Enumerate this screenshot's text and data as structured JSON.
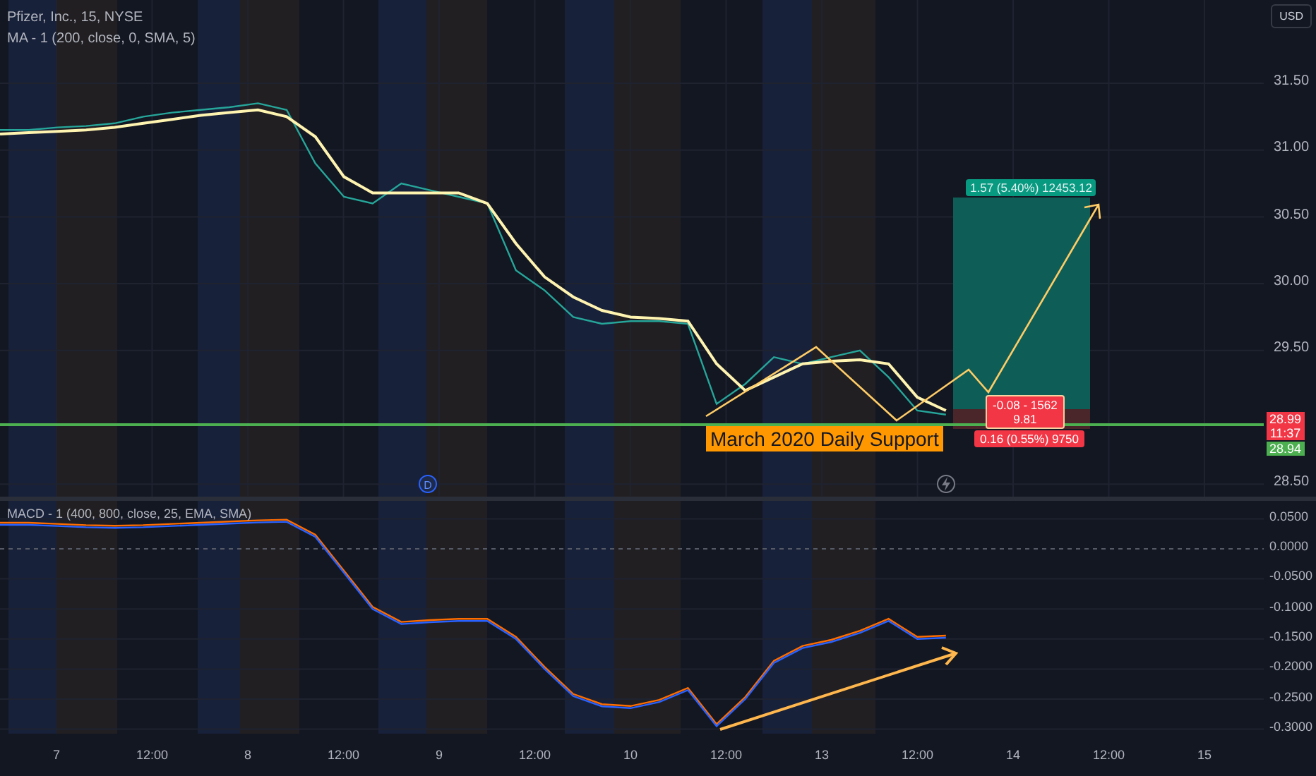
{
  "header": {
    "symbol": "Pfizer, Inc., 15, NYSE",
    "indicator": "MA - 1 (200, close, 0, SMA, 5)"
  },
  "currency_button": "USD",
  "price_pane": {
    "axis_labels": [
      "31.50",
      "31.00",
      "30.50",
      "30.00",
      "29.50",
      "28.50"
    ],
    "support_label": "March 2020 Daily Support",
    "position": {
      "target_label": "1.57 (5.40%) 12453.12",
      "pnl_lines": [
        "-0.08 - 1562",
        "9.81"
      ],
      "stop_label": "0.16 (0.55%) 9750"
    },
    "price_tags": [
      {
        "lines": [
          "28.99",
          "11:37"
        ],
        "color": "#f23645"
      },
      {
        "lines": [
          "28.94"
        ],
        "color": "#4caf50"
      }
    ],
    "dividend_marker": "D"
  },
  "macd_pane": {
    "legend": "MACD - 1 (400, 800, close, 25, EMA, SMA)",
    "axis_labels": [
      "0.0500",
      "0.0000",
      "-0.0500",
      "-0.1000",
      "-0.1500",
      "-0.2000",
      "-0.2500",
      "-0.3000"
    ]
  },
  "time_axis": [
    "7",
    "12:00",
    "8",
    "12:00",
    "9",
    "12:00",
    "10",
    "12:00",
    "13",
    "12:00",
    "14",
    "12:00",
    "15"
  ]
}
